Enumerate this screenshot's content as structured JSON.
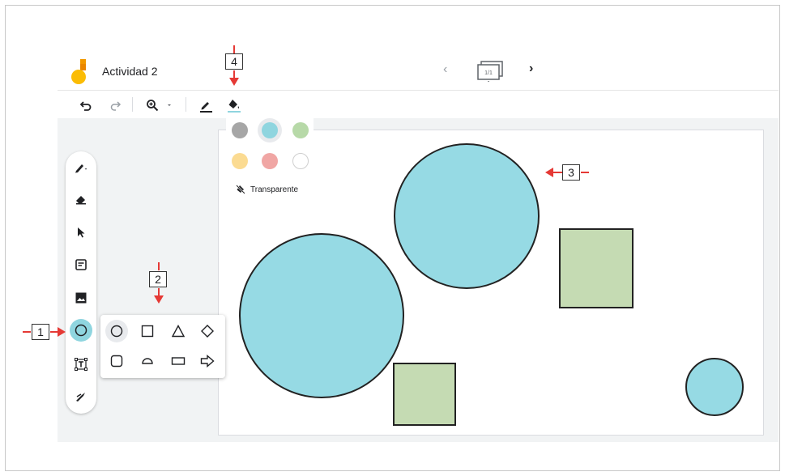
{
  "app": {
    "title": "Actividad 2",
    "frame_counter": "1/1"
  },
  "toolbar": {
    "undo": "undo-icon",
    "redo": "redo-icon",
    "zoom": "zoom-in-icon",
    "zoom_menu": "chevron-down-icon",
    "pen_color": "pen-icon",
    "fill_color": "fill-bucket-icon"
  },
  "rail_tools": [
    {
      "name": "pen",
      "icon": "marker-icon"
    },
    {
      "name": "eraser",
      "icon": "eraser-icon"
    },
    {
      "name": "select",
      "icon": "cursor-icon"
    },
    {
      "name": "sticky-note",
      "icon": "sticky-note-icon"
    },
    {
      "name": "image",
      "icon": "image-icon"
    },
    {
      "name": "shape",
      "icon": "circle-icon",
      "active": true
    },
    {
      "name": "text-box",
      "icon": "text-box-icon"
    },
    {
      "name": "laser",
      "icon": "laser-icon"
    }
  ],
  "shapes": [
    "circle",
    "square",
    "triangle",
    "diamond",
    "rounded-square",
    "semicircle",
    "rectangle",
    "arrow"
  ],
  "colors": {
    "palette": [
      "#a6a6a6",
      "#8fd5df",
      "#b7d9a8",
      "#fbdb92",
      "#f0a6a4",
      "#ffffff"
    ],
    "selected": "#8fd5df",
    "transparent_label": "Transparente",
    "shape_cyan": "#96dae4",
    "shape_green": "#c5dbb3",
    "accent": "#8fd5df",
    "annotation_red": "#e53935"
  },
  "callouts": [
    "1",
    "2",
    "3",
    "4"
  ]
}
